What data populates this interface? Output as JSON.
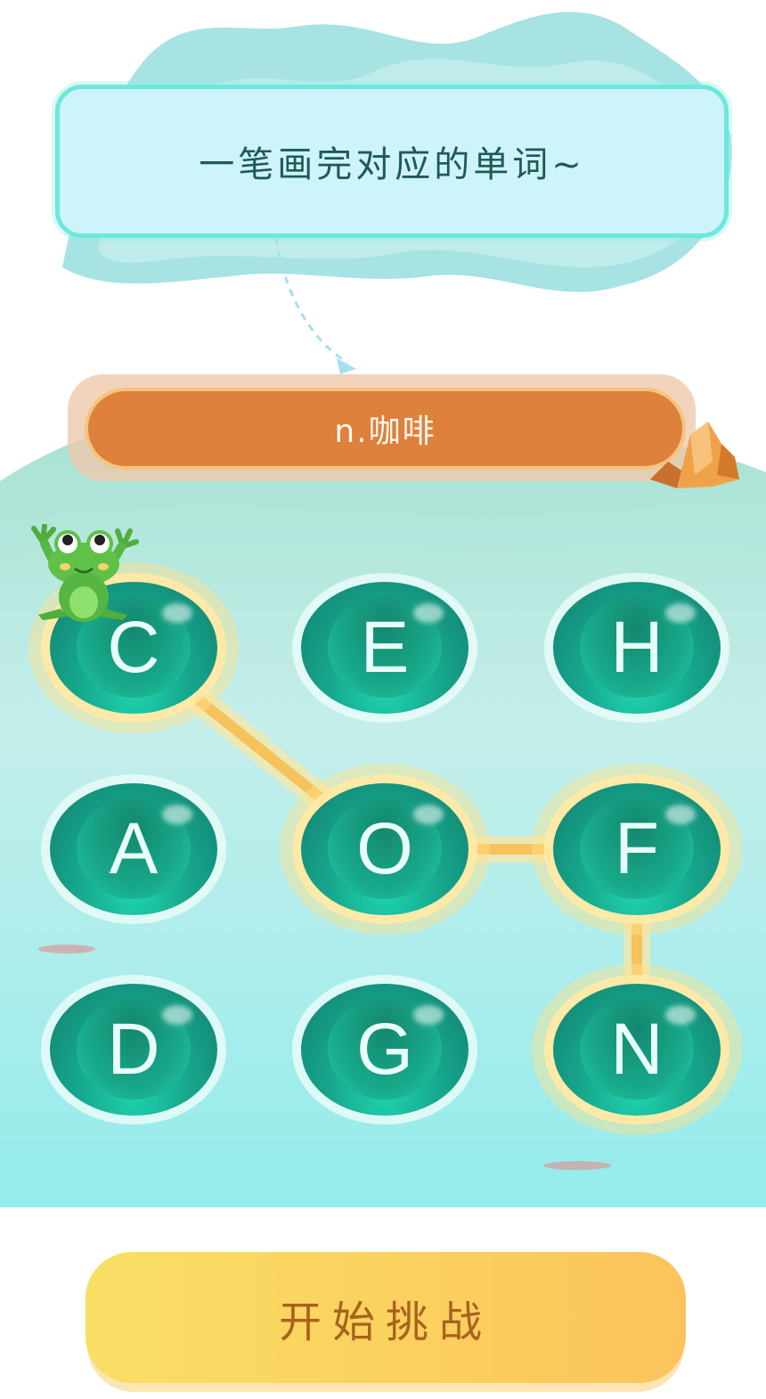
{
  "instruction": "一笔画完对应的单词~",
  "hint": "n.咖啡",
  "grid": [
    {
      "letter": "C",
      "row": 1,
      "col": 1,
      "selected": true
    },
    {
      "letter": "E",
      "row": 1,
      "col": 2,
      "selected": false
    },
    {
      "letter": "H",
      "row": 1,
      "col": 3,
      "selected": false
    },
    {
      "letter": "A",
      "row": 2,
      "col": 1,
      "selected": false
    },
    {
      "letter": "O",
      "row": 2,
      "col": 2,
      "selected": true
    },
    {
      "letter": "F",
      "row": 2,
      "col": 3,
      "selected": true
    },
    {
      "letter": "D",
      "row": 3,
      "col": 1,
      "selected": false
    },
    {
      "letter": "G",
      "row": 3,
      "col": 2,
      "selected": false
    },
    {
      "letter": "N",
      "row": 3,
      "col": 3,
      "selected": true
    }
  ],
  "path": [
    "C",
    "O",
    "F",
    "N"
  ],
  "start_button_label": "开始挑战",
  "colors": {
    "banner_bg": "#cdf3fb",
    "banner_border": "#6ee7dc",
    "hint_plank": "#de813c",
    "pad": "#17a88e",
    "path_line": "#f6c25a",
    "button": "#fbcf5d",
    "button_text": "#a9621e"
  },
  "icons": {
    "frog": "frog-mascot-icon",
    "rock": "orange-rock-icon",
    "arrow": "dashed-arrow-icon"
  }
}
